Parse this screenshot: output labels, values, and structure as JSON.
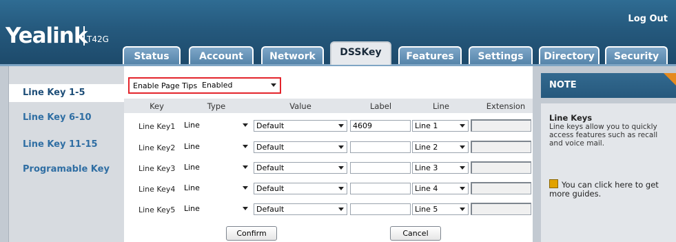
{
  "header": {
    "logo": "Yealink",
    "model": "T42G",
    "logout": "Log Out",
    "tabs": [
      "Status",
      "Account",
      "Network",
      "DSSKey",
      "Features",
      "Settings",
      "Directory",
      "Security"
    ],
    "active_tab": "DSSKey"
  },
  "sidebar": {
    "items": [
      "Line Key 1-5",
      "Line Key 6-10",
      "Line Key 11-15",
      "Programable Key"
    ],
    "active": "Line Key 1-5"
  },
  "page_tips": {
    "label": "Enable Page Tips",
    "value": "Enabled"
  },
  "table": {
    "headers": [
      "Key",
      "Type",
      "Value",
      "Label",
      "Line",
      "Extension"
    ],
    "rows": [
      {
        "key": "Line Key1",
        "type": "Line",
        "value": "Default",
        "label": "4609",
        "line": "Line 1",
        "extension": ""
      },
      {
        "key": "Line Key2",
        "type": "Line",
        "value": "Default",
        "label": "",
        "line": "Line 2",
        "extension": ""
      },
      {
        "key": "Line Key3",
        "type": "Line",
        "value": "Default",
        "label": "",
        "line": "Line 3",
        "extension": ""
      },
      {
        "key": "Line Key4",
        "type": "Line",
        "value": "Default",
        "label": "",
        "line": "Line 4",
        "extension": ""
      },
      {
        "key": "Line Key5",
        "type": "Line",
        "value": "Default",
        "label": "",
        "line": "Line 5",
        "extension": ""
      }
    ]
  },
  "buttons": {
    "confirm": "Confirm",
    "cancel": "Cancel"
  },
  "note": {
    "heading": "NOTE",
    "title": "Line Keys",
    "text": "Line keys allow you to quickly access features such as recall and voice mail.",
    "guide": "You can click here to get more guides."
  },
  "colors": {
    "header": "#25597d",
    "active_link": "#2f6ea3",
    "highlight_border": "#e3242b",
    "note_corner": "#e58a1f"
  }
}
